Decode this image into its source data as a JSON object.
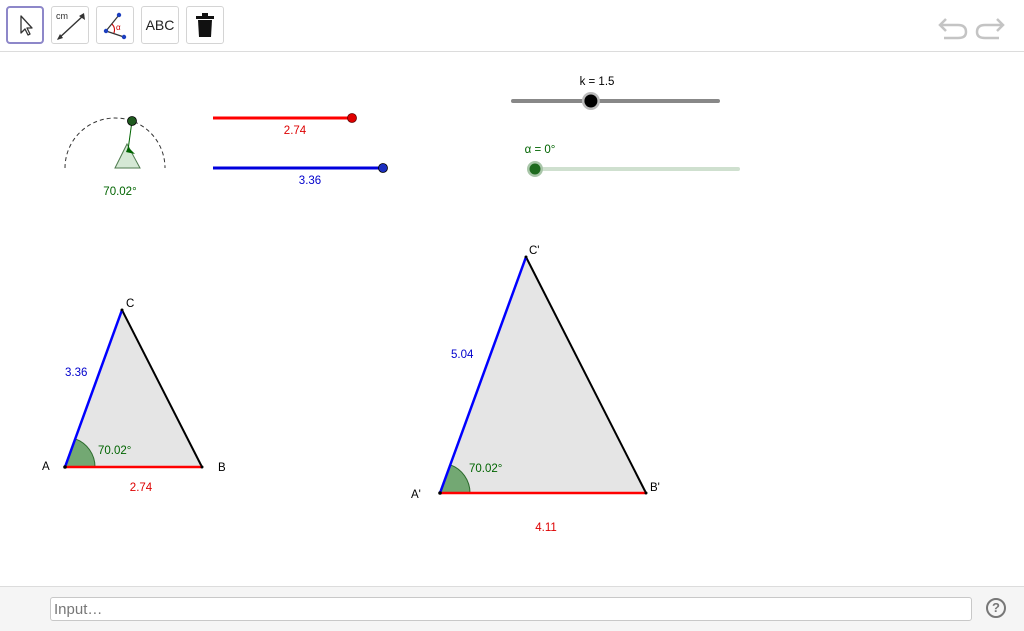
{
  "toolbar": {
    "tools": [
      {
        "name": "move-tool",
        "icon": "cursor-arrow-icon"
      },
      {
        "name": "distance-tool",
        "icon": "distance-ruler-icon",
        "label": "cm"
      },
      {
        "name": "angle-tool",
        "icon": "angle-icon",
        "label": "α"
      },
      {
        "name": "text-tool",
        "icon": "text-icon",
        "label": "ABC"
      },
      {
        "name": "delete-tool",
        "icon": "trash-icon"
      }
    ],
    "undo_icon": "undo-icon",
    "redo_icon": "redo-icon"
  },
  "sliders": {
    "k": {
      "label": "k = 1.5",
      "value": 1.5,
      "fraction": 0.38,
      "color": "#000000"
    },
    "alpha": {
      "label": "α = 0°",
      "value": 0,
      "fraction": 0.0,
      "color": "#006400"
    }
  },
  "angle_control": {
    "label": "70.02°",
    "color": "#006400"
  },
  "length_controls": [
    {
      "label": "2.74",
      "color": "#ff0000"
    },
    {
      "label": "3.36",
      "color": "#0000cc"
    }
  ],
  "triangle_abc": {
    "vertices": {
      "A": "A",
      "B": "B",
      "C": "C"
    },
    "side_ab": "2.74",
    "side_ac": "3.36",
    "angle_a": "70.02°"
  },
  "triangle_image": {
    "vertices": {
      "A": "A'",
      "B": "B'",
      "C": "C'"
    },
    "side_ab": "4.11",
    "side_ac": "5.04",
    "angle_a": "70.02°"
  },
  "colors": {
    "red_side": "#ff0000",
    "blue_side": "#0000ff",
    "angle_green": "#006400",
    "fill_gray": "#e5e5e5"
  },
  "input_bar": {
    "placeholder": "Input…",
    "help_label": "?"
  }
}
